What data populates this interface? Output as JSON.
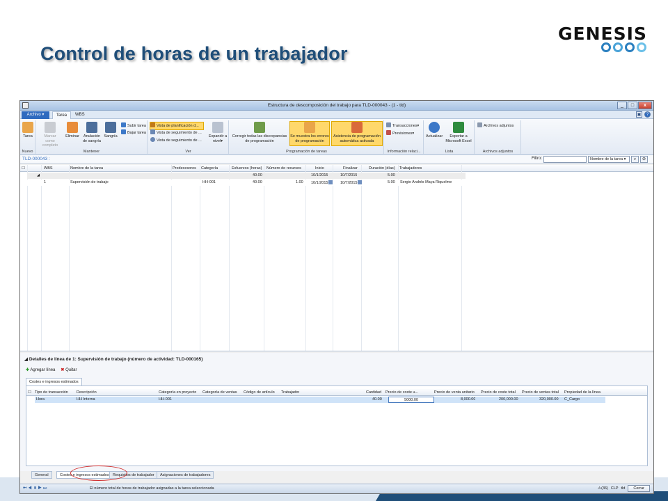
{
  "slide": {
    "title": "Control de horas de un trabajador",
    "logo_text": "GENESIS"
  },
  "window": {
    "title": "Estructura de descomposición del trabajo para TLD-000043 - (1 - tld)",
    "tabs": {
      "archivo": "Archivo ▾",
      "tarea": "Tarea",
      "wbs": "WBS"
    }
  },
  "ribbon": {
    "nuevo": {
      "tarea": "Tarea",
      "label": "Nuevo"
    },
    "mantener": {
      "marcar": "Marcar como completo",
      "eliminar": "Eliminar",
      "anulacion": "Anulación de sangría",
      "sangria": "Sangría",
      "subir": "Subir tarea",
      "bajar": "Bajar tarea",
      "label": "Mantener"
    },
    "ver": {
      "vista1": "Vista de planificación d...",
      "vista2": "Vista de seguimiento de ...",
      "vista3": "Vista de seguimiento de ...",
      "expandir": "Expandir a nivel▾",
      "label": "Ver"
    },
    "programacion": {
      "corregir": "Corregir todas las discrepancias de programación",
      "errores": "Se muestra los errores de programación",
      "asistencia": "Asistencia de programación automática activada",
      "label": "Programación de tareas"
    },
    "info": {
      "transacciones": "Transacciones▾",
      "previsiones": "Previsiones▾",
      "label": "Información relaci..."
    },
    "lista": {
      "actualizar": "Actualizar",
      "exportar": "Exportar a Microsoft Excel",
      "label": "Lista"
    },
    "adjuntos": {
      "archivos": "Archivos adjuntos",
      "label": "Archivos adjuntos"
    }
  },
  "record": {
    "id": "TLD-000043 :",
    "filter_label": "Filtro:",
    "filter_field": "Nombre de la tarea"
  },
  "task_grid": {
    "columns": [
      "WBS",
      "Nombre de la tarea",
      "Predecesores",
      "Categoría",
      "Esfuerzos (horas)",
      "Número de recursos",
      "Inicio",
      "Finalizar",
      "Duración (días)",
      "Trabajadores"
    ],
    "rows": [
      {
        "wbs": "",
        "name": "",
        "pred": "",
        "cat": "",
        "effort": "40.00",
        "resources": "",
        "start": "10/1/2015",
        "end": "10/7/2015",
        "duration": "5.00",
        "workers": ""
      },
      {
        "wbs": "1",
        "name": "Supervisión de trabajo",
        "pred": "",
        "cat": "HH-001",
        "effort": "40.00",
        "resources": "1.00",
        "start": "10/1/2015",
        "end": "10/7/2015",
        "duration": "5.00",
        "workers": "Sergio Andrés Maya Riquelme"
      }
    ]
  },
  "details": {
    "title": "Detalles de línea de 1: Supervisión de trabajo (número de actividad: TLD-000165)",
    "add_line": "Agregar línea",
    "remove": "Quitar",
    "tab": "Costes e ingresos estimados",
    "columns": [
      "Tipo de transacción",
      "Descripción",
      "Categoría en proyecto",
      "Categoría de ventas",
      "Código de artículo",
      "Trabajador",
      "Cantidad",
      "Precio de coste u...",
      "Precio de venta unitario",
      "Precio de coste total",
      "Precio de ventas total",
      "Propiedad de la línea"
    ],
    "row": {
      "tipo": "Hora",
      "descripcion": "HH Interna",
      "categoria": "HH-001",
      "cat_ventas": "",
      "codigo": "",
      "trabajador": "",
      "cantidad": "40.00",
      "precio_coste": "5000.00",
      "precio_venta": "8,000.00",
      "coste_total": "200,000.00",
      "ventas_total": "320,000.00",
      "propiedad": "C_Cargo"
    }
  },
  "bottom_tabs": [
    "General",
    "Costes e ingresos estimados",
    "Requisitos de trabajador",
    "Asignaciones de trabajadores"
  ],
  "status": {
    "message": "El número total de horas de trabajador asignadas a la tarea seleccionada",
    "alerts": "(36)",
    "currency": "CLP",
    "company": "tld",
    "close": "Cerrar"
  }
}
